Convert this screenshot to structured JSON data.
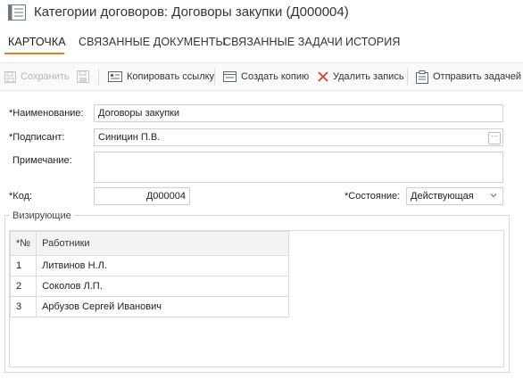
{
  "window": {
    "title": "Категории договоров: Договоры закупки (Д000004)",
    "icon": "document-list-icon"
  },
  "tabs": [
    {
      "label": "КАРТОЧКА",
      "active": true
    },
    {
      "label": "СВЯЗАННЫЕ ДОКУМЕНТЫ",
      "active": false
    },
    {
      "label": "СВЯЗАННЫЕ ЗАДАЧИ",
      "active": false
    },
    {
      "label": "ИСТОРИЯ",
      "active": false
    }
  ],
  "toolbar": {
    "save_label": "Сохранить",
    "copy_link_label": "Копировать ссылку",
    "create_copy_label": "Создать копию",
    "delete_label": "Удалить запись",
    "send_task_label": "Отправить задачей"
  },
  "form": {
    "name_label": "*Наименование:",
    "name_value": "Договоры закупки",
    "signer_label": "*Подписант:",
    "signer_value": "Синицин П.В.",
    "note_label": "Примечание:",
    "note_value": "",
    "code_label": "*Код:",
    "code_value": "Д000004",
    "state_label": "*Состояние:",
    "state_value": "Действующая"
  },
  "approvers": {
    "title": "Визирующие",
    "columns": [
      "*№",
      "Работники"
    ],
    "rows": [
      {
        "num": "1",
        "name": "Литвинов Н.Л."
      },
      {
        "num": "2",
        "name": "Соколов Л.П."
      },
      {
        "num": "3",
        "name": "Арбузов Сергей Иванович"
      }
    ]
  },
  "colors": {
    "accent": "#f07c1c",
    "delete": "#e0322b"
  }
}
